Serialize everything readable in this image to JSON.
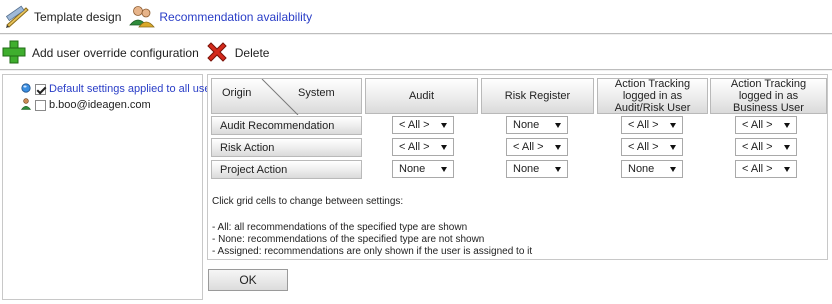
{
  "toolbar": {
    "template_design_label": "Template design",
    "recommendation_availability_label": "Recommendation availability",
    "add_override_label": "Add user override configuration",
    "delete_label": "Delete"
  },
  "tree": {
    "items": [
      {
        "label": "Default settings applied to all users",
        "checked": true,
        "selected": true
      },
      {
        "label": "b.boo@ideagen.com",
        "checked": false,
        "selected": false
      }
    ]
  },
  "grid": {
    "corner_origin": "Origin",
    "corner_system": "System",
    "columns": [
      "Audit",
      "Risk Register",
      "Action Tracking logged in as Audit/Risk User",
      "Action Tracking logged in as Business User"
    ],
    "rows": [
      {
        "label": "Audit Recommendation",
        "values": [
          "< All >",
          "None",
          "< All >",
          "< All >"
        ]
      },
      {
        "label": "Risk Action",
        "values": [
          "< All >",
          "< All >",
          "< All >",
          "< All >"
        ]
      },
      {
        "label": "Project Action",
        "values": [
          "None",
          "None",
          "None",
          "< All >"
        ]
      }
    ]
  },
  "help": {
    "intro": "Click grid cells to change between settings:",
    "lines": [
      "- All: all recommendations of the specified type are shown",
      "- None: recommendations of the specified type are not shown",
      "- Assigned: recommendations are only shown if the user is assigned to it"
    ]
  },
  "ok_label": "OK"
}
